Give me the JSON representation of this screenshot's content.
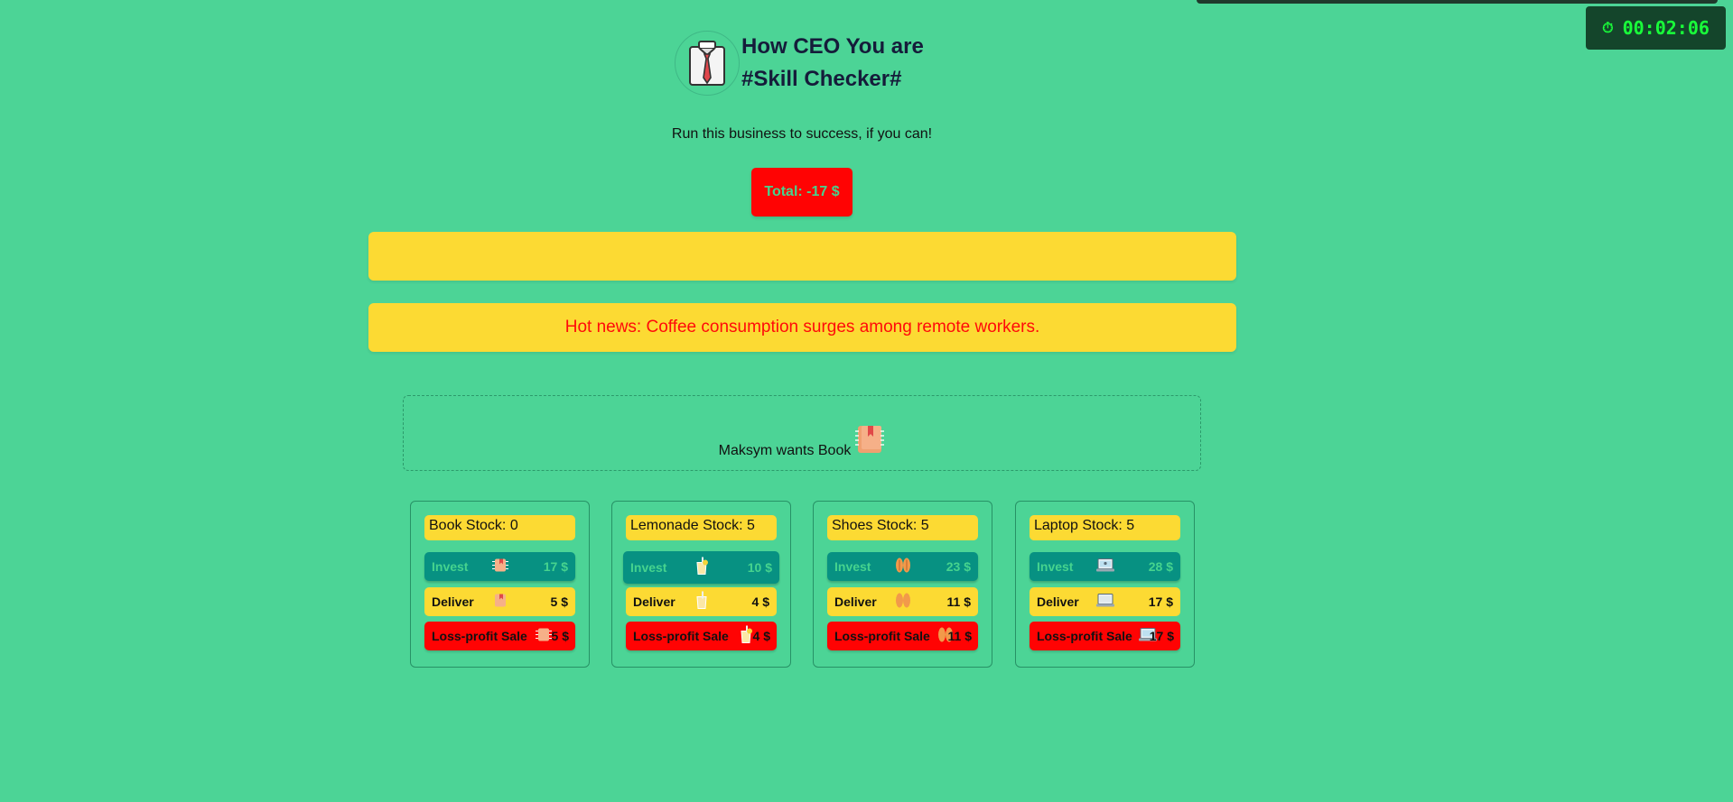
{
  "header": {
    "title_line1": "How CEO You are",
    "title_line2": "#Skill Checker#",
    "subtitle": "Run this business to success, if you can!",
    "logo_icon": "shirt-tie-icon"
  },
  "timer": {
    "icon": "stopwatch-icon",
    "value": "00:02:06"
  },
  "total": {
    "label": "Total: -17 $"
  },
  "banners": {
    "top_text": "",
    "news_text": "Hot news: Coffee consumption surges among remote workers."
  },
  "customer": {
    "text": "Maksym wants Book",
    "icon": "book-icon"
  },
  "products": [
    {
      "stock": "Book Stock: 0",
      "invest_label": "Invest",
      "invest_price": "17 $",
      "deliver_label": "Deliver",
      "deliver_price": "5 $",
      "sale_label": "Loss-profit Sale",
      "sale_price": "5 $",
      "icon": "book-icon"
    },
    {
      "stock": "Lemonade Stock: 5",
      "invest_label": "Invest",
      "invest_price": "10 $",
      "deliver_label": "Deliver",
      "deliver_price": "4 $",
      "sale_label": "Loss-profit Sale",
      "sale_price": "4 $",
      "icon": "lemonade-icon"
    },
    {
      "stock": "Shoes Stock: 5",
      "invest_label": "Invest",
      "invest_price": "23 $",
      "deliver_label": "Deliver",
      "deliver_price": "11 $",
      "sale_label": "Loss-profit Sale",
      "sale_price": "11 $",
      "icon": "shoes-icon"
    },
    {
      "stock": "Laptop Stock: 5",
      "invest_label": "Invest",
      "invest_price": "28 $",
      "deliver_label": "Deliver",
      "deliver_price": "17 $",
      "sale_label": "Loss-profit Sale",
      "sale_price": "17 $",
      "icon": "laptop-icon"
    }
  ],
  "colors": {
    "background": "#4cd496",
    "accent_yellow": "#fcda33",
    "alert_red": "#ff0303",
    "invest_teal": "#079182",
    "timer_bg": "#14452b",
    "timer_text": "#19ff3a"
  }
}
